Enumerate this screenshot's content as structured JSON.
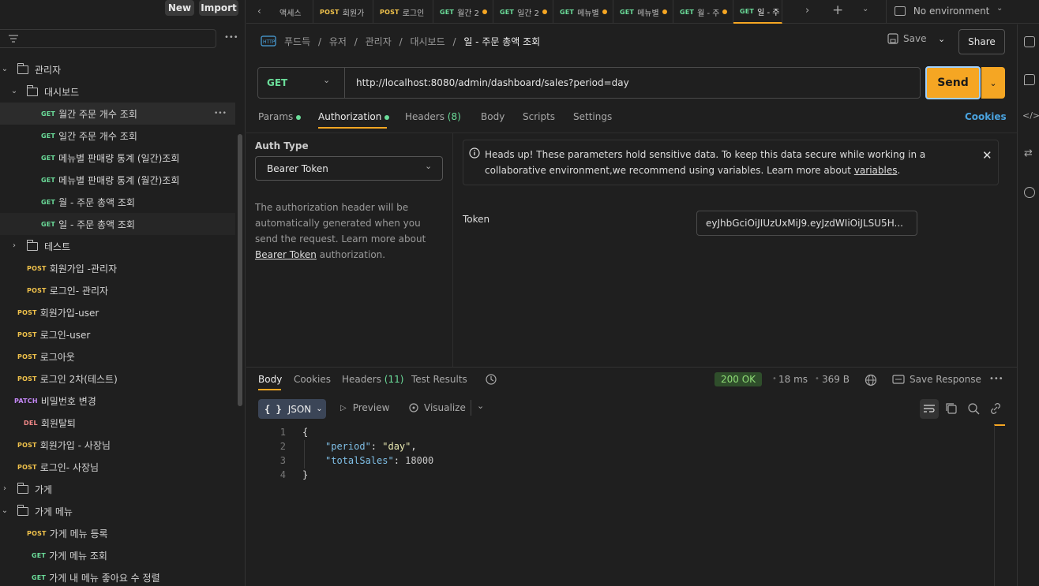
{
  "sidebar": {
    "new_label": "New",
    "import_label": "Import",
    "more_label": "•••",
    "items": [
      {
        "label": "관리자",
        "type": "folder",
        "level": 1,
        "open": true
      },
      {
        "label": "대시보드",
        "type": "folder",
        "level": 2,
        "open": true
      },
      {
        "label": "월간 주문 개수 조회",
        "method": "GET",
        "level": 3,
        "state": "selected"
      },
      {
        "label": "일간 주문 개수 조회",
        "method": "GET",
        "level": 3
      },
      {
        "label": "메뉴별 판매량 통계 (일간)조회",
        "method": "GET",
        "level": 3
      },
      {
        "label": "메뉴별 판매량 통계 (월간)조회",
        "method": "GET",
        "level": 3
      },
      {
        "label": "월 - 주문 총액 조회",
        "method": "GET",
        "level": 3
      },
      {
        "label": "일 - 주문 총액 조회",
        "method": "GET",
        "level": 3,
        "state": "active"
      },
      {
        "label": "테스트",
        "type": "folder",
        "level": 2,
        "open": false
      },
      {
        "label": "회원가입 -관리자",
        "method": "POST",
        "level": 2
      },
      {
        "label": "로그인- 관리자",
        "method": "POST",
        "level": 2
      },
      {
        "label": "회원가입-user",
        "method": "POST",
        "level": 1
      },
      {
        "label": "로그인-user",
        "method": "POST",
        "level": 1
      },
      {
        "label": "로그아웃",
        "method": "POST",
        "level": 1
      },
      {
        "label": "로그인 2차(테스트)",
        "method": "POST",
        "level": 1
      },
      {
        "label": "비밀번호 변경",
        "method": "PATCH",
        "level": 1
      },
      {
        "label": "회원탈퇴",
        "method": "DEL",
        "level": 1
      },
      {
        "label": "회원가입 - 사장님",
        "method": "POST",
        "level": 1
      },
      {
        "label": "로그인- 사장님",
        "method": "POST",
        "level": 1
      },
      {
        "label": "가게",
        "type": "folder",
        "level": 1,
        "open": false
      },
      {
        "label": "가게 메뉴",
        "type": "folder",
        "level": 1,
        "open": true
      },
      {
        "label": "가게 메뉴 등록",
        "method": "POST",
        "level": 2
      },
      {
        "label": "가게 메뉴 조회",
        "method": "GET",
        "level": 2
      },
      {
        "label": "가게 내 메뉴 좋아요 수 정렬",
        "method": "GET",
        "level": 2
      }
    ]
  },
  "tabs": [
    {
      "method": "",
      "label": "액세스",
      "dot": false
    },
    {
      "method": "POST",
      "label": "회원가",
      "dot": false
    },
    {
      "method": "POST",
      "label": "로그인",
      "dot": false
    },
    {
      "method": "GET",
      "label": "월간 2",
      "dot": true
    },
    {
      "method": "GET",
      "label": "일간 2",
      "dot": true
    },
    {
      "method": "GET",
      "label": "메뉴별",
      "dot": true
    },
    {
      "method": "GET",
      "label": "메뉴별",
      "dot": true
    },
    {
      "method": "GET",
      "label": "월 - 주",
      "dot": true
    },
    {
      "method": "GET",
      "label": "일 - 주",
      "dot": true,
      "active": true
    }
  ],
  "environment": "No environment",
  "breadcrumb": [
    "푸드득",
    "유저",
    "관리자",
    "대시보드"
  ],
  "request_title": "일 - 주문 총액 조회",
  "save_label": "Save",
  "share_label": "Share",
  "method": "GET",
  "url": "http://localhost:8080/admin/dashboard/sales?period=day",
  "send_label": "Send",
  "request_tabs": {
    "params": "Params",
    "authorization": "Authorization",
    "headers": "Headers",
    "headers_count": "(8)",
    "body": "Body",
    "scripts": "Scripts",
    "settings": "Settings",
    "cookies": "Cookies"
  },
  "auth": {
    "type_label": "Auth Type",
    "type_value": "Bearer Token",
    "description_pre": "The authorization header will be automatically generated when you send the request. Learn more about",
    "description_link": "Bearer Token",
    "description_post": "authorization.",
    "notice_pre": "Heads up! These parameters hold sensitive data. To keep this data secure while working in a collaborative environment,we recommend using variables. Learn more about",
    "notice_link": "variables",
    "notice_post": ".",
    "token_label": "Token",
    "token_value": "eyJhbGciOiJIUzUxMiJ9.eyJzdWIiOiJLSU5H..."
  },
  "response": {
    "tabs": {
      "body": "Body",
      "cookies": "Cookies",
      "headers": "Headers",
      "headers_count": "(11)",
      "test_results": "Test Results"
    },
    "status": "200 OK",
    "time": "18 ms",
    "size": "369 B",
    "save_response": "Save Response",
    "format": "JSON",
    "preview": "Preview",
    "visualize": "Visualize",
    "lines": [
      "1",
      "2",
      "3",
      "4"
    ],
    "json": {
      "open": "{",
      "k1": "\"period\"",
      "v1": "\"day\"",
      "k2": "\"totalSales\"",
      "v2": "18000",
      "close": "}"
    }
  },
  "colors": {
    "accent": "#f5a623",
    "get": "#6bdd9a",
    "post": "#f0c24b",
    "patch": "#c387f5",
    "del": "#f58a8a"
  }
}
